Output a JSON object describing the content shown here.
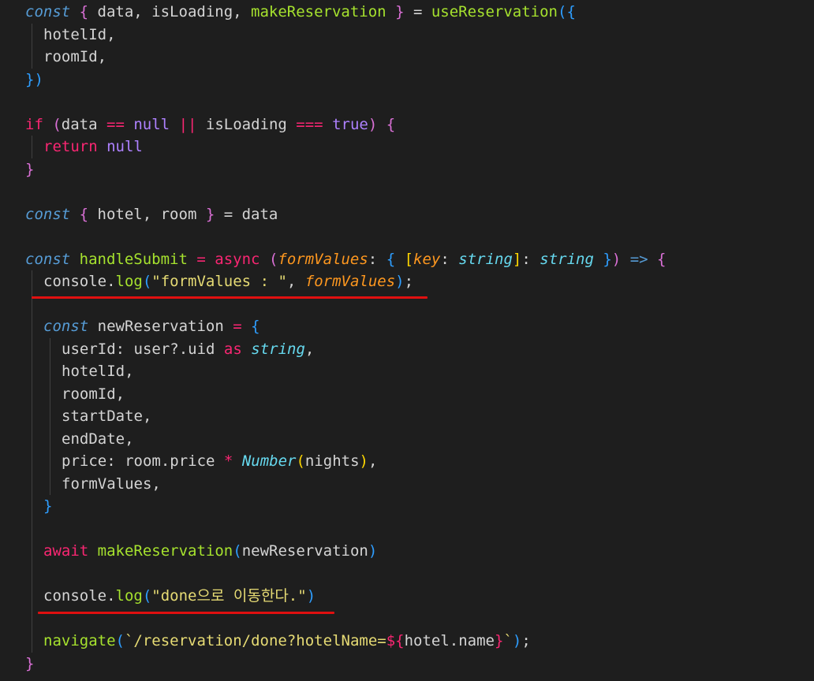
{
  "colors": {
    "background": "#1e1e1e",
    "default": "#d4d4d4",
    "keyword_storage": "#569cd6",
    "keyword_control": "#f92672",
    "function": "#a6e22e",
    "string": "#e6db74",
    "parameter": "#fd971f",
    "type": "#66d9ef",
    "bracket_1": "#2e9eff",
    "bracket_2": "#da70d6",
    "bracket_3": "#ffd700",
    "indent_guide": "#404040",
    "annotation_underline": "#e01010"
  },
  "lines": [
    {
      "indent": 0,
      "tokens": [
        {
          "t": "const",
          "c": "kw-i"
        },
        {
          "t": " "
        },
        {
          "t": "{",
          "c": "br2"
        },
        {
          "t": " data, isLoading, "
        },
        {
          "t": "makeReservation",
          "c": "fn"
        },
        {
          "t": " "
        },
        {
          "t": "}",
          "c": "br2"
        },
        {
          "t": " = "
        },
        {
          "t": "useReservation",
          "c": "fn"
        },
        {
          "t": "(",
          "c": "br1"
        },
        {
          "t": "{",
          "c": "br1"
        }
      ]
    },
    {
      "indent": 1,
      "tokens": [
        {
          "t": "hotelId,"
        }
      ]
    },
    {
      "indent": 1,
      "tokens": [
        {
          "t": "roomId,"
        }
      ]
    },
    {
      "indent": 0,
      "tokens": [
        {
          "t": "}",
          "c": "br1"
        },
        {
          "t": ")",
          "c": "br1"
        }
      ]
    },
    {
      "indent": 0,
      "tokens": []
    },
    {
      "indent": 0,
      "tokens": [
        {
          "t": "if",
          "c": "ctl"
        },
        {
          "t": " "
        },
        {
          "t": "(",
          "c": "br2"
        },
        {
          "t": "data "
        },
        {
          "t": "==",
          "c": "ctl"
        },
        {
          "t": " "
        },
        {
          "t": "null",
          "c": "op"
        },
        {
          "t": " "
        },
        {
          "t": "||",
          "c": "ctl"
        },
        {
          "t": " isLoading "
        },
        {
          "t": "===",
          "c": "ctl"
        },
        {
          "t": " "
        },
        {
          "t": "true",
          "c": "op"
        },
        {
          "t": ")",
          "c": "br2"
        },
        {
          "t": " "
        },
        {
          "t": "{",
          "c": "br2"
        }
      ]
    },
    {
      "indent": 1,
      "tokens": [
        {
          "t": "return",
          "c": "ctl"
        },
        {
          "t": " "
        },
        {
          "t": "null",
          "c": "op"
        }
      ]
    },
    {
      "indent": 0,
      "tokens": [
        {
          "t": "}",
          "c": "br2"
        }
      ]
    },
    {
      "indent": 0,
      "tokens": []
    },
    {
      "indent": 0,
      "tokens": [
        {
          "t": "const",
          "c": "kw-i"
        },
        {
          "t": " "
        },
        {
          "t": "{",
          "c": "br2"
        },
        {
          "t": " hotel, room "
        },
        {
          "t": "}",
          "c": "br2"
        },
        {
          "t": " = data"
        }
      ]
    },
    {
      "indent": 0,
      "tokens": []
    },
    {
      "indent": 0,
      "tokens": [
        {
          "t": "const",
          "c": "kw-i"
        },
        {
          "t": " "
        },
        {
          "t": "handleSubmit",
          "c": "fn"
        },
        {
          "t": " "
        },
        {
          "t": "=",
          "c": "ctl"
        },
        {
          "t": " "
        },
        {
          "t": "async",
          "c": "ctl"
        },
        {
          "t": " "
        },
        {
          "t": "(",
          "c": "br2"
        },
        {
          "t": "formValues",
          "c": "par"
        },
        {
          "t": ": "
        },
        {
          "t": "{",
          "c": "br1"
        },
        {
          "t": " "
        },
        {
          "t": "[",
          "c": "br3"
        },
        {
          "t": "key",
          "c": "par"
        },
        {
          "t": ": "
        },
        {
          "t": "string",
          "c": "typ"
        },
        {
          "t": "]",
          "c": "br3"
        },
        {
          "t": ": "
        },
        {
          "t": "string",
          "c": "typ"
        },
        {
          "t": " "
        },
        {
          "t": "}",
          "c": "br1"
        },
        {
          "t": ")",
          "c": "br2"
        },
        {
          "t": " "
        },
        {
          "t": "=>",
          "c": "kw"
        },
        {
          "t": " "
        },
        {
          "t": "{",
          "c": "br2"
        }
      ]
    },
    {
      "indent": 1,
      "underline": 1,
      "tokens": [
        {
          "t": "console."
        },
        {
          "t": "log",
          "c": "fn"
        },
        {
          "t": "(",
          "c": "br1"
        },
        {
          "t": "\"formValues : \"",
          "c": "str"
        },
        {
          "t": ", "
        },
        {
          "t": "formValues",
          "c": "par"
        },
        {
          "t": ")",
          "c": "br1"
        },
        {
          "t": ";"
        }
      ]
    },
    {
      "indent": 0,
      "tokens": []
    },
    {
      "indent": 1,
      "tokens": [
        {
          "t": "const",
          "c": "kw-i"
        },
        {
          "t": " newReservation "
        },
        {
          "t": "=",
          "c": "ctl"
        },
        {
          "t": " "
        },
        {
          "t": "{",
          "c": "br1"
        }
      ]
    },
    {
      "indent": 2,
      "tokens": [
        {
          "t": "userId: user?.uid "
        },
        {
          "t": "as",
          "c": "ctl"
        },
        {
          "t": " "
        },
        {
          "t": "string",
          "c": "typ"
        },
        {
          "t": ","
        }
      ]
    },
    {
      "indent": 2,
      "tokens": [
        {
          "t": "hotelId,"
        }
      ]
    },
    {
      "indent": 2,
      "tokens": [
        {
          "t": "roomId,"
        }
      ]
    },
    {
      "indent": 2,
      "tokens": [
        {
          "t": "startDate,"
        }
      ]
    },
    {
      "indent": 2,
      "tokens": [
        {
          "t": "endDate,"
        }
      ]
    },
    {
      "indent": 2,
      "tokens": [
        {
          "t": "price: room.price "
        },
        {
          "t": "*",
          "c": "ctl"
        },
        {
          "t": " "
        },
        {
          "t": "Number",
          "c": "typ"
        },
        {
          "t": "(",
          "c": "br3"
        },
        {
          "t": "nights"
        },
        {
          "t": ")",
          "c": "br3"
        },
        {
          "t": ","
        }
      ]
    },
    {
      "indent": 2,
      "tokens": [
        {
          "t": "formValues,"
        }
      ]
    },
    {
      "indent": 1,
      "tokens": [
        {
          "t": "}",
          "c": "br1"
        }
      ]
    },
    {
      "indent": 0,
      "tokens": []
    },
    {
      "indent": 1,
      "tokens": [
        {
          "t": "await",
          "c": "ctl"
        },
        {
          "t": " "
        },
        {
          "t": "makeReservation",
          "c": "fn"
        },
        {
          "t": "(",
          "c": "br1"
        },
        {
          "t": "newReservation"
        },
        {
          "t": ")",
          "c": "br1"
        }
      ]
    },
    {
      "indent": 0,
      "tokens": []
    },
    {
      "indent": 1,
      "underline": 2,
      "tokens": [
        {
          "t": "console."
        },
        {
          "t": "log",
          "c": "fn"
        },
        {
          "t": "(",
          "c": "br1"
        },
        {
          "t": "\"done으로 이동한다.\"",
          "c": "str"
        },
        {
          "t": ")",
          "c": "br1"
        }
      ]
    },
    {
      "indent": 0,
      "tokens": []
    },
    {
      "indent": 1,
      "tokens": [
        {
          "t": "navigate",
          "c": "fn"
        },
        {
          "t": "(",
          "c": "br1"
        },
        {
          "t": "`/reservation/done?hotelName=",
          "c": "str"
        },
        {
          "t": "${",
          "c": "ctl"
        },
        {
          "t": "hotel.name"
        },
        {
          "t": "}",
          "c": "ctl"
        },
        {
          "t": "`",
          "c": "str"
        },
        {
          "t": ")",
          "c": "br1"
        },
        {
          "t": ";"
        }
      ]
    },
    {
      "indent": 0,
      "tokens": [
        {
          "t": "}",
          "c": "br2"
        }
      ]
    }
  ]
}
